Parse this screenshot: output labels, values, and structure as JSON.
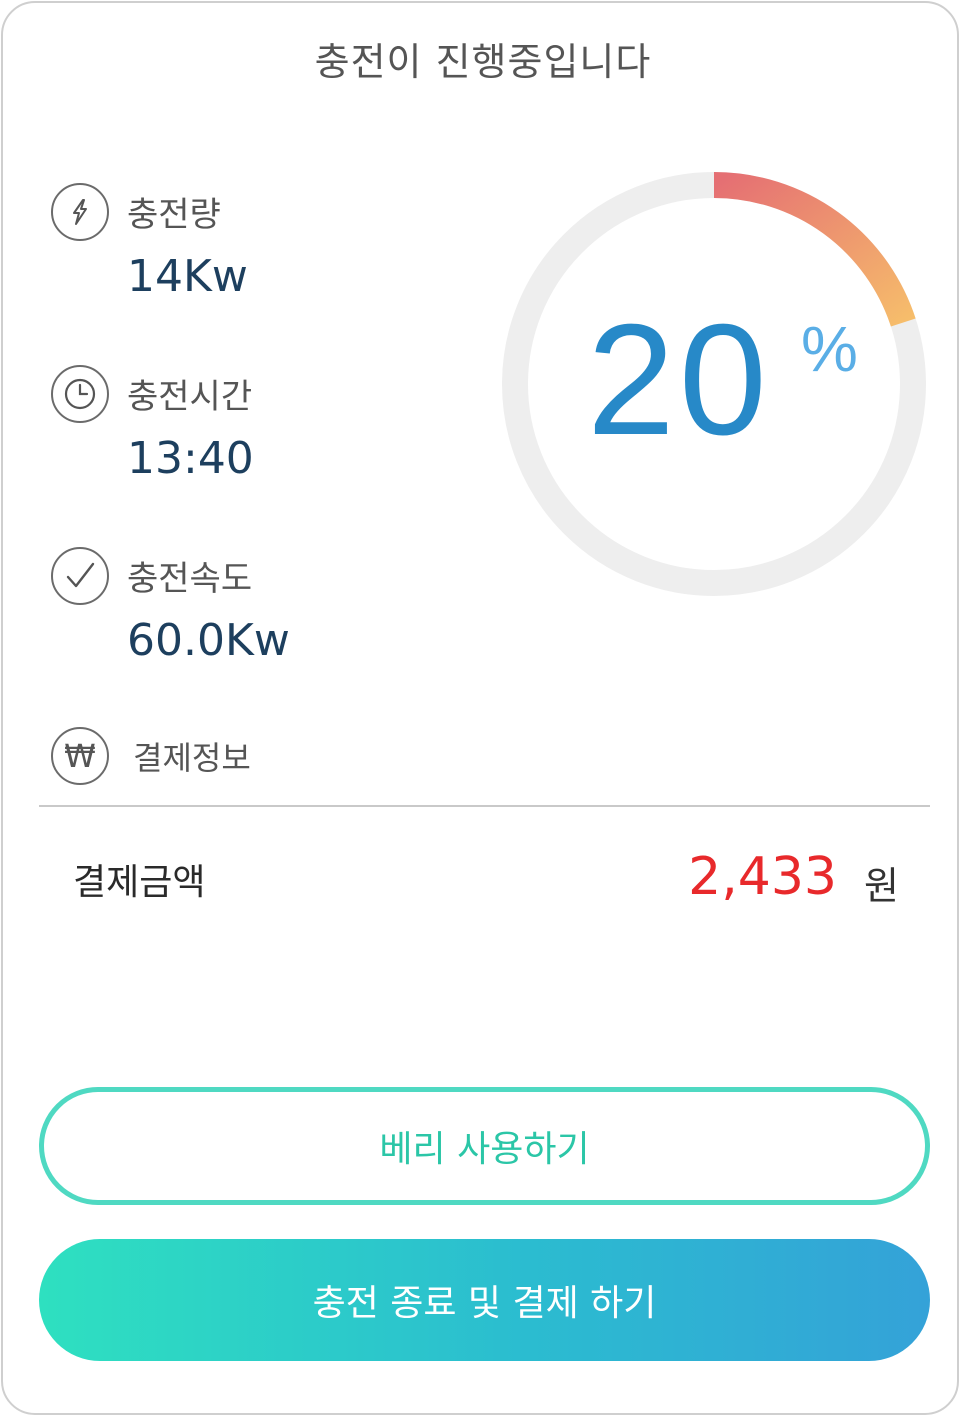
{
  "header": {
    "title": "충전이 진행중입니다"
  },
  "stats": [
    {
      "label": "충전량",
      "value": "14Kw",
      "icon": "lightning-icon"
    },
    {
      "label": "충전시간",
      "value": "13:40",
      "icon": "clock-icon"
    },
    {
      "label": "충전속도",
      "value": "60.0Kw",
      "icon": "check-icon"
    }
  ],
  "payment": {
    "section_label": "결제정보",
    "currency_symbol": "₩",
    "amount_label": "결제금액",
    "amount_value": "2,433",
    "amount_unit": "원"
  },
  "gauge": {
    "percent_text": "20",
    "percent_sign": "%",
    "progress": 0.2,
    "colors": {
      "track": "#eeeeee",
      "start": "#e56f73",
      "end": "#f6bd6b",
      "number": "#2789c8"
    }
  },
  "actions": {
    "berry_button": "베리 사용하기",
    "finish_button": "충전 종료 및 결제 하기"
  }
}
